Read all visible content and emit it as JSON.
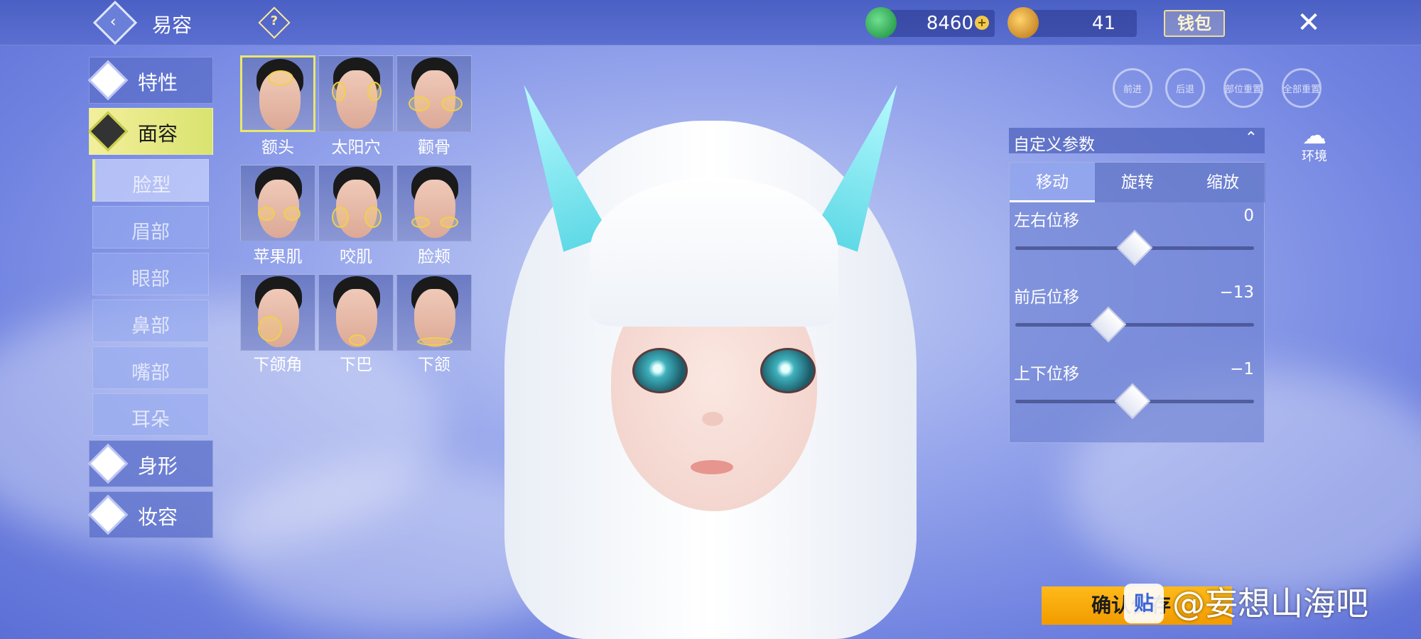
{
  "topbar": {
    "title": "易容",
    "help_icon": "?",
    "jade_amount": "8460",
    "gold_amount": "41",
    "wallet_label": "钱包"
  },
  "menu": {
    "categories": [
      {
        "label": "特性",
        "active": false
      },
      {
        "label": "面容",
        "active": true
      },
      {
        "label": "身形",
        "active": false
      },
      {
        "label": "妆容",
        "active": false
      }
    ],
    "subcategories": [
      {
        "label": "脸型",
        "active": true
      },
      {
        "label": "眉部",
        "active": false
      },
      {
        "label": "眼部",
        "active": false
      },
      {
        "label": "鼻部",
        "active": false
      },
      {
        "label": "嘴部",
        "active": false
      },
      {
        "label": "耳朵",
        "active": false
      }
    ]
  },
  "face_parts": [
    {
      "label": "额头",
      "selected": true
    },
    {
      "label": "太阳穴",
      "selected": false
    },
    {
      "label": "颧骨",
      "selected": false
    },
    {
      "label": "苹果肌",
      "selected": false
    },
    {
      "label": "咬肌",
      "selected": false
    },
    {
      "label": "脸颊",
      "selected": false
    },
    {
      "label": "下颌角",
      "selected": false
    },
    {
      "label": "下巴",
      "selected": false
    },
    {
      "label": "下颔",
      "selected": false
    }
  ],
  "toolbar": {
    "forward": "前进",
    "back": "后退",
    "reset_part": "部位重置",
    "reset_all": "全部重置",
    "environment": "环境"
  },
  "panel": {
    "title": "自定义参数",
    "tabs": [
      "移动",
      "旋转",
      "缩放"
    ],
    "sliders": [
      {
        "label": "左右位移",
        "value": "0",
        "fraction": 0.5
      },
      {
        "label": "前后位移",
        "value": "−13",
        "fraction": 0.39
      },
      {
        "label": "上下位移",
        "value": "−1",
        "fraction": 0.49
      }
    ]
  },
  "confirm_label": "确认保存",
  "watermark": "@妄想山海吧",
  "watermark_logo": "贴",
  "colors": {
    "accent_yellow": "#e9e86a",
    "confirm_orange": "#f5a300",
    "panel_blue": "#6e82d2"
  }
}
